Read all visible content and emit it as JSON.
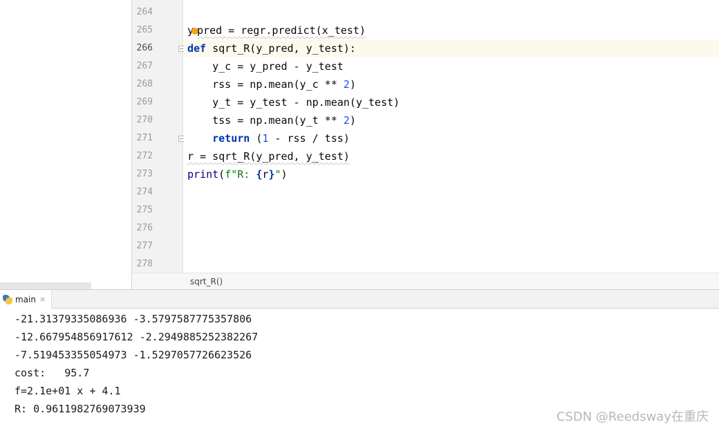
{
  "editor": {
    "line_numbers": [
      "264",
      "265",
      "266",
      "267",
      "268",
      "269",
      "270",
      "271",
      "272",
      "273",
      "274",
      "275",
      "276",
      "277",
      "278"
    ],
    "active_line": "266",
    "code": {
      "l265": {
        "a": "y",
        "b": "pred = regr.predict(x_test)"
      },
      "l266": {
        "kw": "def",
        "rest": " sqrt_R(y_pred, y_test):"
      },
      "l267": {
        "text": "    y_c = y_pred - y_test"
      },
      "l268": {
        "a": "    rss = np.mean(y_c ** ",
        "n": "2",
        "b": ")"
      },
      "l269": {
        "text": "    y_t = y_test - np.mean(y_test)"
      },
      "l270": {
        "a": "    tss = np.mean(y_t ** ",
        "n": "2",
        "b": ")"
      },
      "l271": {
        "ind": "    ",
        "kw": "return",
        "a": " (",
        "n": "1",
        "b": " - rss / tss)"
      },
      "l272": {
        "text": "r = sqrt_R(y_pred, y_test)"
      },
      "l273": {
        "fn": "print",
        "p1": "(",
        "fs": "f\"R: ",
        "ob": "{",
        "var": "r",
        "cb": "}",
        "fe": "\"",
        "p2": ")"
      }
    },
    "breadcrumb": "sqrt_R()"
  },
  "run_panel": {
    "tab_label": "main",
    "tab_close": "×",
    "output": [
      "-21.31379335086936 -3.5797587775357806",
      "-12.667954856917612 -2.2949885252382267",
      "-7.519453355054973 -1.5297057726623526",
      "cost:   95.7",
      "f=2.1e+01 x + 4.1",
      "R: 0.9611982769073939"
    ]
  },
  "watermark": "CSDN @Reedsway在重庆",
  "colors": {
    "keyword": "#0033b3",
    "number": "#1750eb",
    "fstring": "#067d17",
    "highlight_line": "#fcfaed",
    "gutter": "#f2f2f2"
  },
  "icons": {
    "tab": "python-icon",
    "close": "close-icon",
    "bulb": "intention-bulb-icon"
  }
}
